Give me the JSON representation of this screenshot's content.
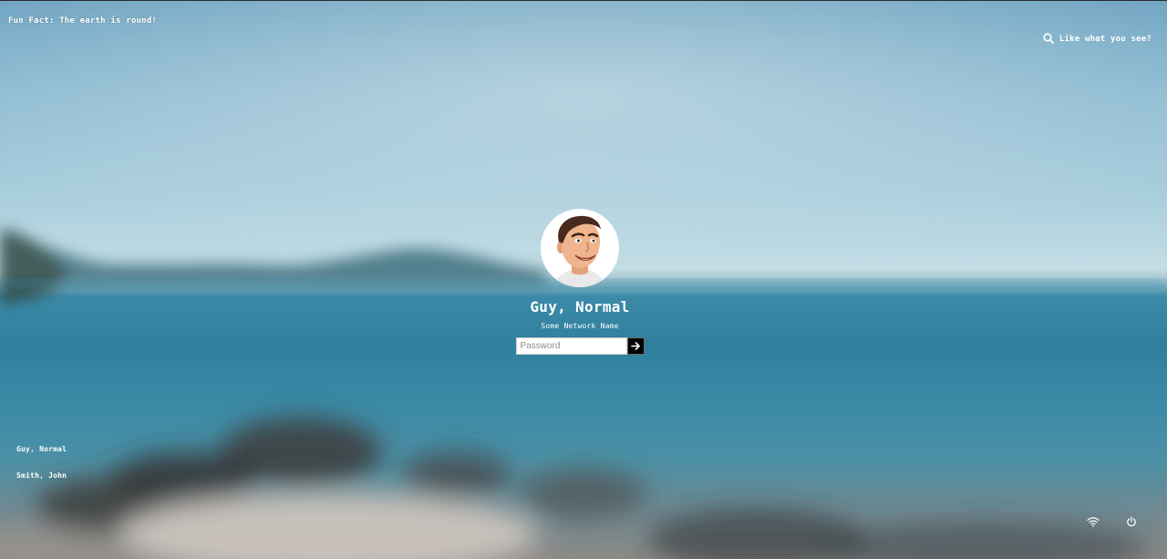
{
  "fun_fact": "Fun Fact: The earth is round!",
  "header": {
    "like_label": "Like what you see?",
    "icon": "search-icon"
  },
  "login": {
    "avatar_icon": "avatar",
    "user_name": "Guy, Normal",
    "network_name": "Some Network Name",
    "password_placeholder": "Password",
    "submit_icon": "arrow-right-icon"
  },
  "users": [
    {
      "name": "Guy, Normal"
    },
    {
      "name": "Smith, John"
    }
  ],
  "system": {
    "wifi_icon": "wifi-icon",
    "power_icon": "power-icon"
  },
  "colors": {
    "sky": "#a9cedd",
    "sea": "#2f7f9e",
    "submit_bg": "#000000",
    "text": "#ffffff"
  }
}
